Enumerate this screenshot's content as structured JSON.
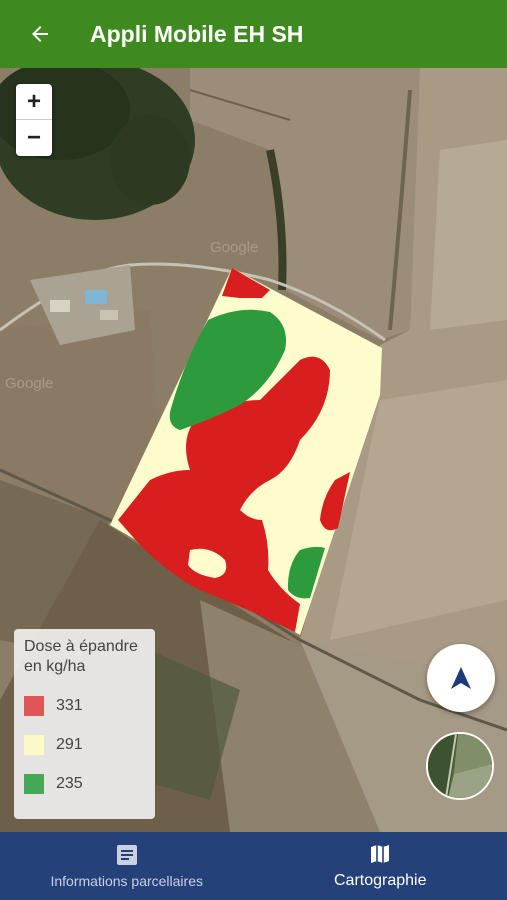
{
  "app": {
    "title": "Appli Mobile EH SH",
    "back_icon": "arrow-left-icon"
  },
  "map": {
    "zoom_in_label": "+",
    "zoom_out_label": "−",
    "watermark_1": "Google",
    "watermark_2": "Google"
  },
  "legend": {
    "title_line1": "Dose à épandre",
    "title_line2": "en kg/ha",
    "items": [
      {
        "value": "331",
        "color": "#e05555"
      },
      {
        "value": "291",
        "color": "#fafac8"
      },
      {
        "value": "235",
        "color": "#45a857"
      }
    ]
  },
  "zone_colors": {
    "high": "#d91e1e",
    "mid": "#fdfccc",
    "low": "#2d9a3e"
  },
  "bottom_nav": {
    "items": [
      {
        "label": "Informations parcellaires",
        "icon": "document-icon",
        "active": false
      },
      {
        "label": "Cartographie",
        "icon": "map-icon",
        "active": true
      }
    ]
  },
  "accent_colors": {
    "appbar": "#3e8a1f",
    "bottom_nav": "#24417a",
    "locate_arrow": "#1f3a7a"
  }
}
